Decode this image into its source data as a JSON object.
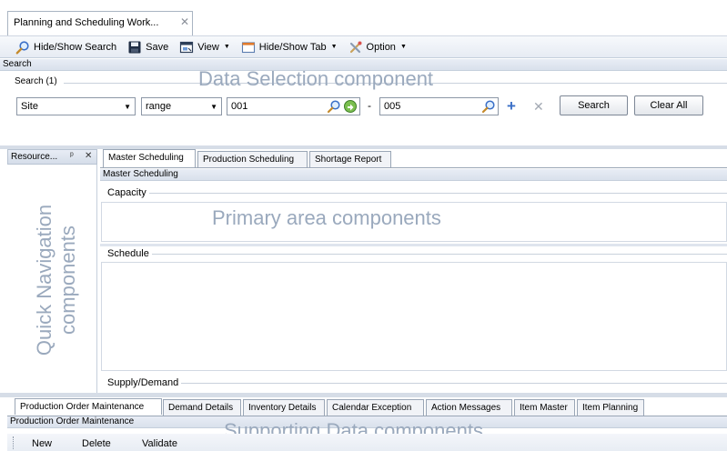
{
  "window": {
    "tab_title": "Planning and Scheduling Work..."
  },
  "toolbar": {
    "hide_show_search": "Hide/Show Search",
    "save": "Save",
    "view": "View",
    "hide_show_tab": "Hide/Show Tab",
    "option": "Option"
  },
  "search_panel": {
    "section_title": "Search",
    "group_label": "Search (1)",
    "field_dropdown": "Site",
    "operator_dropdown": "range",
    "from_value": "001",
    "range_separator": "-",
    "to_value": "005",
    "search_button": "Search",
    "clear_all_button": "Clear All",
    "component_label": "Data Selection component"
  },
  "quick_nav": {
    "title": "Resource...",
    "component_label_line1": "Quick Navigation",
    "component_label_line2": "components"
  },
  "primary": {
    "tabs": [
      "Master Scheduling",
      "Production Scheduling",
      "Shortage Report"
    ],
    "active_tab_title": "Master Scheduling",
    "groups": {
      "capacity": "Capacity",
      "schedule": "Schedule",
      "supply_demand": "Supply/Demand"
    },
    "component_label": "Primary area components"
  },
  "supporting": {
    "tabs": [
      "Production Order Maintenance",
      "Demand Details",
      "Inventory Details",
      "Calendar Exception",
      "Action Messages",
      "Item Master",
      "Item Planning"
    ],
    "active_tab_title": "Production Order Maintenance",
    "actions": {
      "new": "New",
      "delete": "Delete",
      "validate": "Validate"
    },
    "component_label": "Supporting Data components"
  },
  "colors": {
    "accent_blue": "#3a6fc7",
    "watermark": "#9aa9bd",
    "panel_header": "#dde4ee"
  }
}
